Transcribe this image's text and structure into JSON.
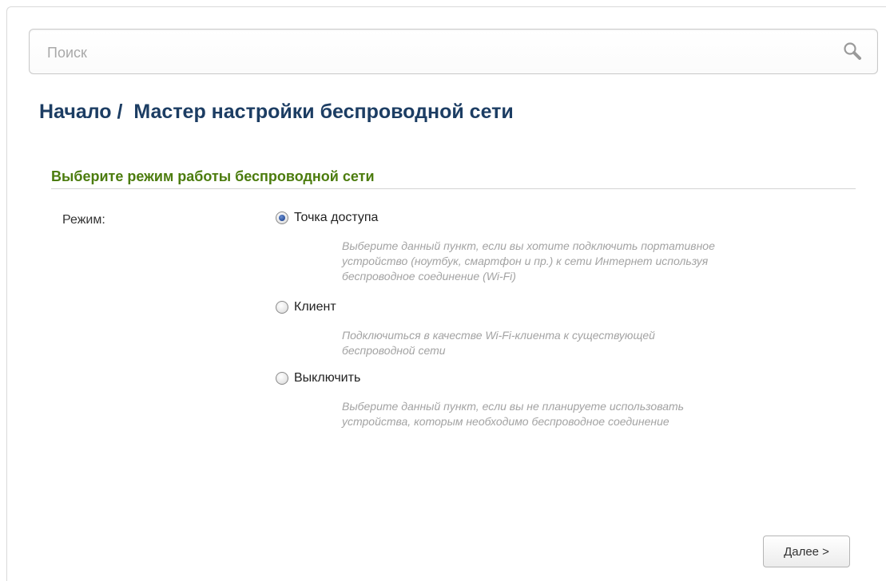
{
  "search": {
    "placeholder": "Поиск",
    "value": ""
  },
  "breadcrumb": {
    "home": "Начало",
    "separator": " /  ",
    "current": "Мастер настройки беспроводной сети"
  },
  "section": {
    "title": "Выберите режим работы беспроводной сети"
  },
  "mode": {
    "label": "Режим:",
    "selected": "access_point",
    "options": [
      {
        "id": "access_point",
        "label": "Точка доступа",
        "hint_lines": [
          "Выберите данный пункт, если вы хотите подключить портативное",
          "устройство (ноутбук, смартфон и пр.) к сети Интернет используя",
          "беспроводное соединение (Wi-Fi)"
        ]
      },
      {
        "id": "client",
        "label": "Клиент",
        "hint_lines": [
          "Подключиться в качестве Wi-Fi-клиента к существующей",
          "беспроводной сети"
        ]
      },
      {
        "id": "off",
        "label": "Выключить",
        "hint_lines": [
          "Выберите данный пункт, если вы не планируете использовать",
          "устройства, которым необходимо беспроводное соединение"
        ]
      }
    ]
  },
  "footer": {
    "next_label": "Далее >"
  },
  "colors": {
    "title": "#1c3d63",
    "section_title": "#4c7c0e",
    "hint": "#a3a3a3"
  },
  "icons": {
    "search": "search-icon",
    "radio": "radio-icon"
  }
}
